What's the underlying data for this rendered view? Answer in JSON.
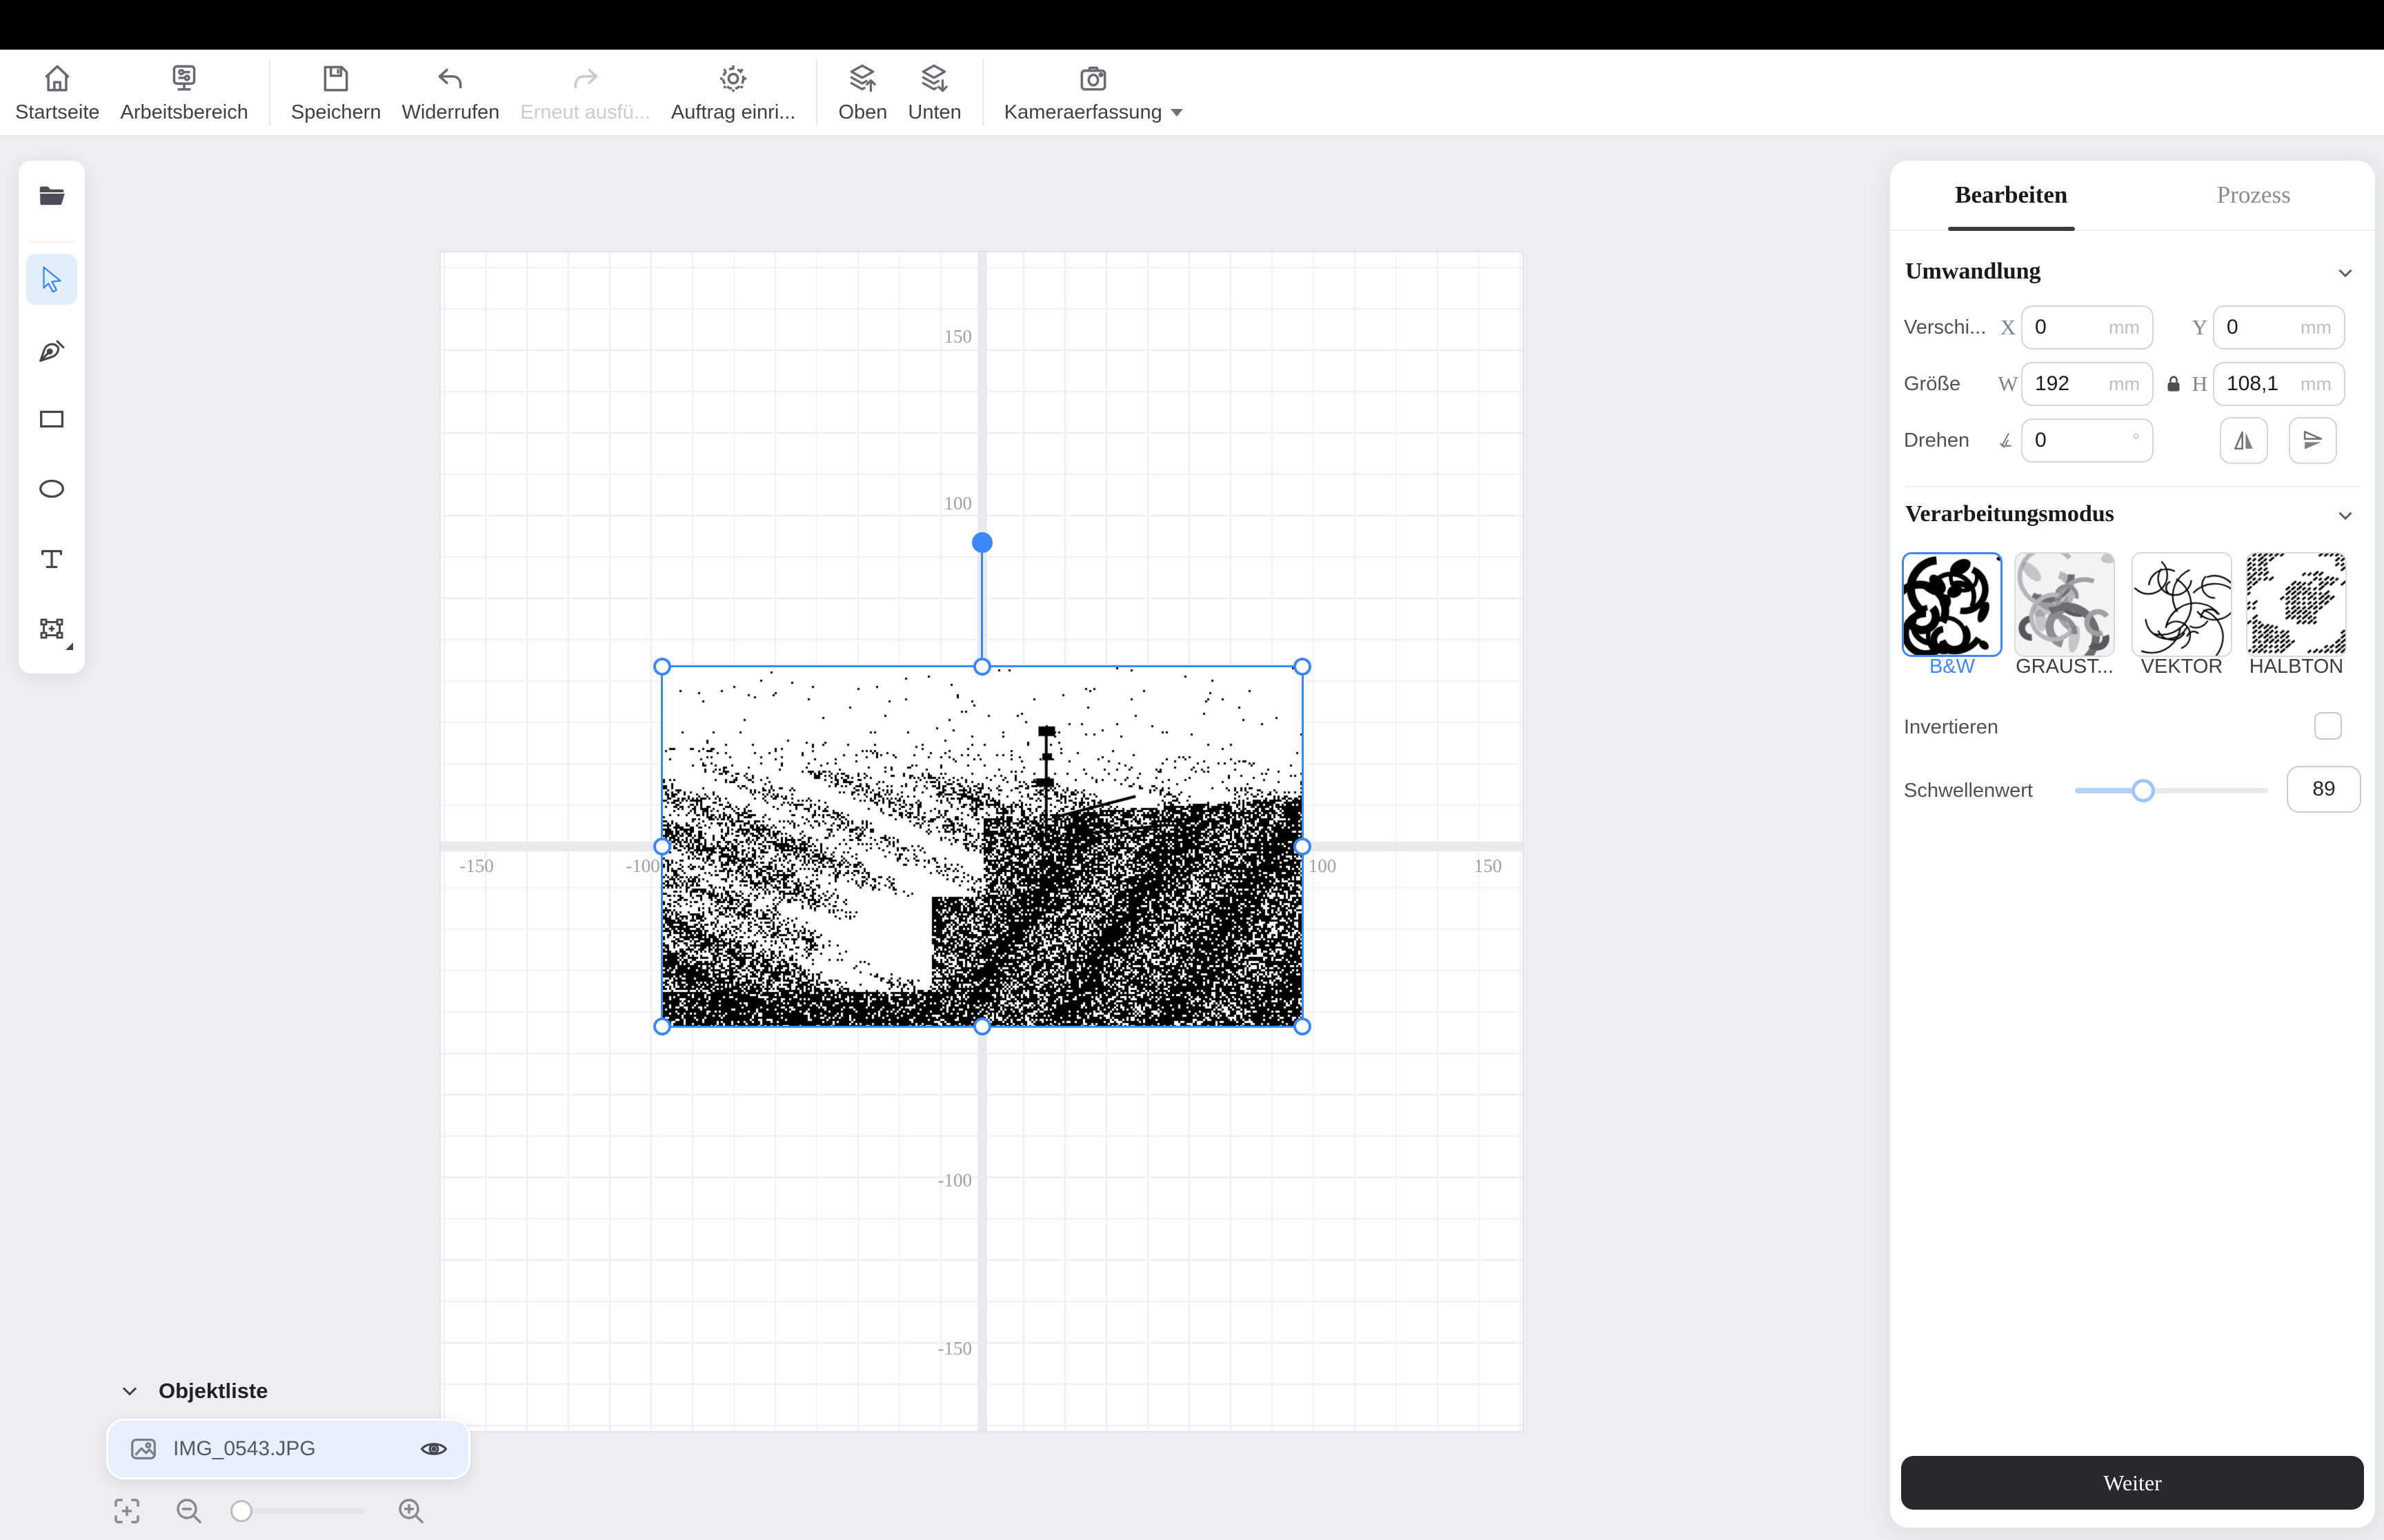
{
  "toolbar": {
    "items": [
      {
        "label": "Startseite"
      },
      {
        "label": "Arbeitsbereich"
      },
      {
        "label": "Speichern"
      },
      {
        "label": "Widerrufen"
      },
      {
        "label": "Erneut ausfü...",
        "disabled": true
      },
      {
        "label": "Auftrag einri..."
      },
      {
        "label": "Oben"
      },
      {
        "label": "Unten"
      },
      {
        "label": "Kameraerfassung",
        "has_dropdown": true
      }
    ]
  },
  "tools": {
    "items": [
      {
        "name": "import-file"
      },
      {
        "name": "select",
        "selected": true
      },
      {
        "name": "pen"
      },
      {
        "name": "rectangle"
      },
      {
        "name": "ellipse"
      },
      {
        "name": "text"
      },
      {
        "name": "capture-frame"
      }
    ]
  },
  "canvas": {
    "ruler_x": [
      "-150",
      "-100",
      "100",
      "150"
    ],
    "ruler_y": [
      "150",
      "100",
      "-100",
      "-150"
    ]
  },
  "object_list": {
    "title": "Objektliste",
    "items": [
      {
        "filename": "IMG_0543.JPG"
      }
    ]
  },
  "panel": {
    "tabs": [
      {
        "label": "Bearbeiten",
        "active": true
      },
      {
        "label": "Prozess",
        "active": false
      }
    ],
    "umwandlung": {
      "title": "Umwandlung",
      "move_label": "Verschi...",
      "x_letter": "X",
      "x_value": "0",
      "x_unit": "mm",
      "y_letter": "Y",
      "y_value": "0",
      "y_unit": "mm",
      "size_label": "Größe",
      "w_letter": "W",
      "w_value": "192",
      "w_unit": "mm",
      "h_letter": "H",
      "h_value": "108,1",
      "h_unit": "mm",
      "locked": true,
      "rotate_label": "Drehen",
      "rotate_value": "0",
      "rotate_unit": "°"
    },
    "mode": {
      "title": "Verarbeitungsmodus",
      "options": [
        {
          "label": "B&W",
          "selected": true
        },
        {
          "label": "GRAUST...",
          "selected": false
        },
        {
          "label": "VEKTOR",
          "selected": false
        },
        {
          "label": "HALBTON",
          "selected": false
        }
      ],
      "invert_label": "Invertieren",
      "invert_checked": false,
      "threshold_label": "Schwellenwert",
      "threshold_value": "89"
    },
    "next_label": "Weiter"
  },
  "colors": {
    "accent": "#3e87f8",
    "page_bg": "#eceef1",
    "dark_button": "#26282d",
    "axis_band": "#e8eaee"
  }
}
